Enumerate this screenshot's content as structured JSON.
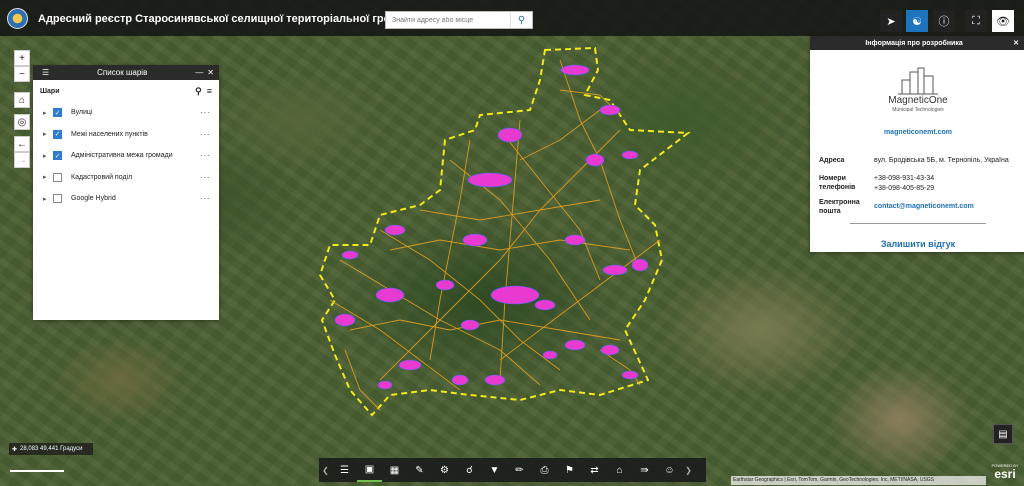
{
  "header": {
    "title": "Адресний реєстр Старосинявської селищної територіальної громади",
    "search_placeholder": "Знайти адресу або місце"
  },
  "top_buttons": [
    {
      "icon": "share-icon"
    },
    {
      "icon": "accessibility-icon"
    },
    {
      "icon": "info-icon"
    },
    {
      "icon": "fullscreen-icon"
    },
    {
      "icon": "eye-icon"
    }
  ],
  "layers_panel": {
    "title": "Список шарів",
    "subtitle": "Шари",
    "layers": [
      {
        "name": "Вулиці",
        "checked": true
      },
      {
        "name": "Межі населених пунктів",
        "checked": true
      },
      {
        "name": "Адміністративна межа громади",
        "checked": true
      },
      {
        "name": "Кадастровий поділ",
        "checked": false
      },
      {
        "name": "Google Hybrid",
        "checked": false
      }
    ]
  },
  "info_panel": {
    "title": "Інформація про розробника",
    "company_name": "MagneticOne",
    "company_tagline": "Municipal Technologies",
    "company_site": "magneticonemt.com",
    "address_label": "Адреса",
    "address_value": "вул. Бродівська 5Б, м. Тернопіль, Україна",
    "phones_label_1": "Номери",
    "phones_label_2": "телефонів",
    "phone_1": "+38-098-931-43-34",
    "phone_2": "+38-098-405-85-29",
    "email_label_1": "Електронна",
    "email_label_2": "пошта",
    "email_value": "contact@magneticonemt.com",
    "feedback": "Залишити відгук"
  },
  "coords": "28,083 49,441 Градуси",
  "attribution": "Earthstar Geographics | Esri, TomTom, Garmin, GeoTechnologies, Inc, METI/NASA, USGS",
  "esri": {
    "powered": "POWERED BY",
    "brand": "esri"
  },
  "colors": {
    "boundary": "#f2ea1c",
    "streets": "#e8a020",
    "settlements": "#e83ad0",
    "accent": "#1e73be"
  }
}
